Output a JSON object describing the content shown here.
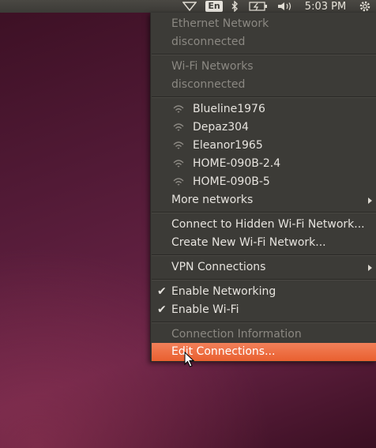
{
  "panel": {
    "keyboard_layout": "En",
    "clock": "5:03 PM",
    "icons": [
      "network-icon",
      "keyboard-layout-icon",
      "bluetooth-icon",
      "battery-icon",
      "volume-icon",
      "clock",
      "gear-icon"
    ]
  },
  "menu": {
    "ethernet_header": "Ethernet Network",
    "ethernet_status": "disconnected",
    "wifi_header": "Wi-Fi Networks",
    "wifi_status": "disconnected",
    "networks": [
      "Blueline1976",
      "Depaz304",
      "Eleanor1965",
      "HOME-090B-2.4",
      "HOME-090B-5"
    ],
    "more_networks": "More networks",
    "connect_hidden": "Connect to Hidden Wi-Fi Network...",
    "create_new": "Create New Wi-Fi Network...",
    "vpn": "VPN Connections",
    "enable_networking": "Enable Networking",
    "enable_wifi": "Enable Wi-Fi",
    "connection_info": "Connection Information",
    "edit_connections": "Edit Connections..."
  },
  "colors": {
    "panel_bg": "#3c3b37",
    "menu_bg": "#3c3b37",
    "highlight": "#e9602f",
    "disabled_text": "#8b8882",
    "desktop": "#521a36"
  }
}
